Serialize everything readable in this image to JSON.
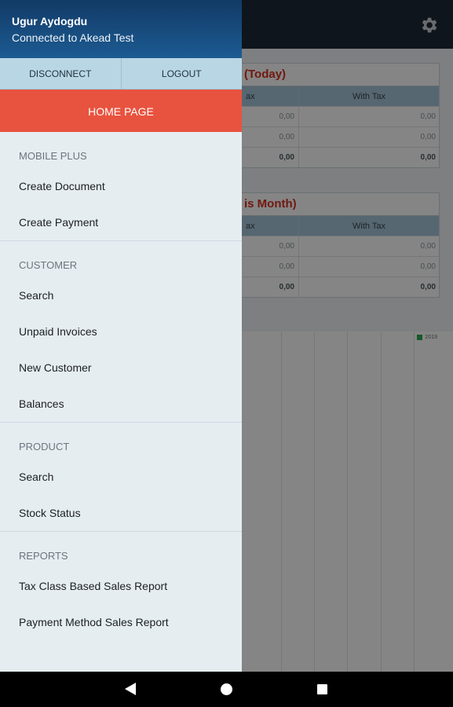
{
  "background": {
    "today_panel": {
      "title": "(Today)",
      "columns": [
        "ax",
        "With Tax"
      ],
      "rows": [
        [
          "0,00",
          "0,00"
        ],
        [
          "0,00",
          "0,00"
        ]
      ],
      "total": [
        "0,00",
        "0,00"
      ]
    },
    "month_panel": {
      "title": "is Month)",
      "columns": [
        "ax",
        "With Tax"
      ],
      "rows": [
        [
          "0,00",
          "0,00"
        ],
        [
          "0,00",
          "0,00"
        ]
      ],
      "total": [
        "0,00",
        "0,00"
      ]
    },
    "chart_legend": "2019"
  },
  "drawer": {
    "user_name": "Ugur Aydogdu",
    "connection_status": "Connected to Akead Test",
    "disconnect_label": "DISCONNECT",
    "logout_label": "LOGOUT",
    "home_label": "HOME PAGE",
    "sections": [
      {
        "title": "MOBILE PLUS",
        "items": [
          "Create Document",
          "Create Payment"
        ]
      },
      {
        "title": "CUSTOMER",
        "items": [
          "Search",
          "Unpaid Invoices",
          "New Customer",
          "Balances"
        ]
      },
      {
        "title": "PRODUCT",
        "items": [
          "Search",
          "Stock Status"
        ]
      },
      {
        "title": "REPORTS",
        "items": [
          "Tax Class Based Sales Report",
          "Payment Method Sales Report"
        ]
      }
    ]
  },
  "colors": {
    "accent": "#e8533f",
    "header": "#1c5b92",
    "button_row": "#b9d6e4",
    "drawer_bg": "#e6edf1"
  },
  "icons": {
    "settings": "gear-icon",
    "back": "back-icon",
    "home": "home-icon",
    "recents": "recents-icon"
  }
}
